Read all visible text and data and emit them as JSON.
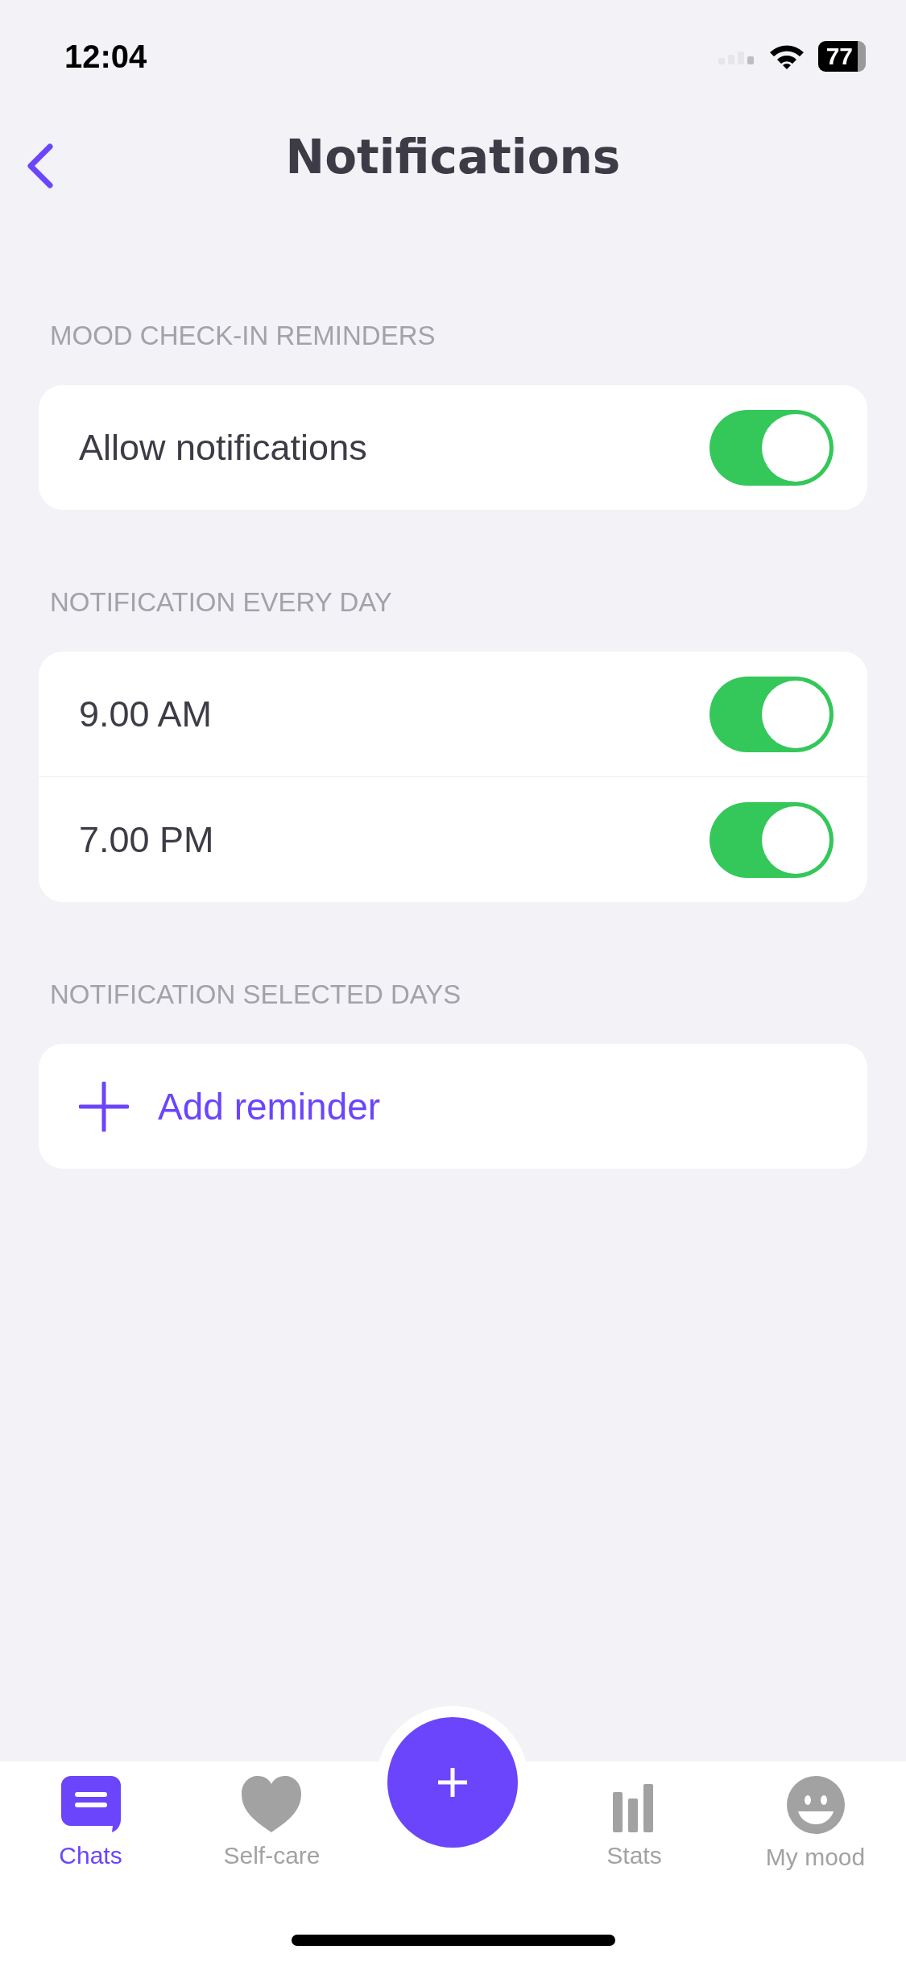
{
  "status_bar": {
    "time": "12:04",
    "battery": "77"
  },
  "nav": {
    "title": "Notifications"
  },
  "sections": [
    {
      "header": "MOOD CHECK-IN REMINDERS",
      "rows": [
        {
          "kind": "toggle",
          "label": "Allow notifications",
          "on": true
        }
      ]
    },
    {
      "header": "NOTIFICATION EVERY DAY",
      "rows": [
        {
          "kind": "toggle",
          "label": "9.00 AM",
          "on": true
        },
        {
          "kind": "toggle",
          "label": "7.00 PM",
          "on": true
        }
      ]
    },
    {
      "header": "NOTIFICATION SELECTED DAYS",
      "rows": [
        {
          "kind": "action",
          "label": "Add reminder"
        }
      ]
    }
  ],
  "tabs": [
    {
      "kind": "chat",
      "label": "Chats",
      "selected": true
    },
    {
      "kind": "heart",
      "label": "Self-care",
      "selected": false
    },
    {
      "kind": "add"
    },
    {
      "kind": "stats",
      "label": "Stats",
      "selected": false
    },
    {
      "kind": "mood",
      "label": "My mood",
      "selected": false
    }
  ]
}
